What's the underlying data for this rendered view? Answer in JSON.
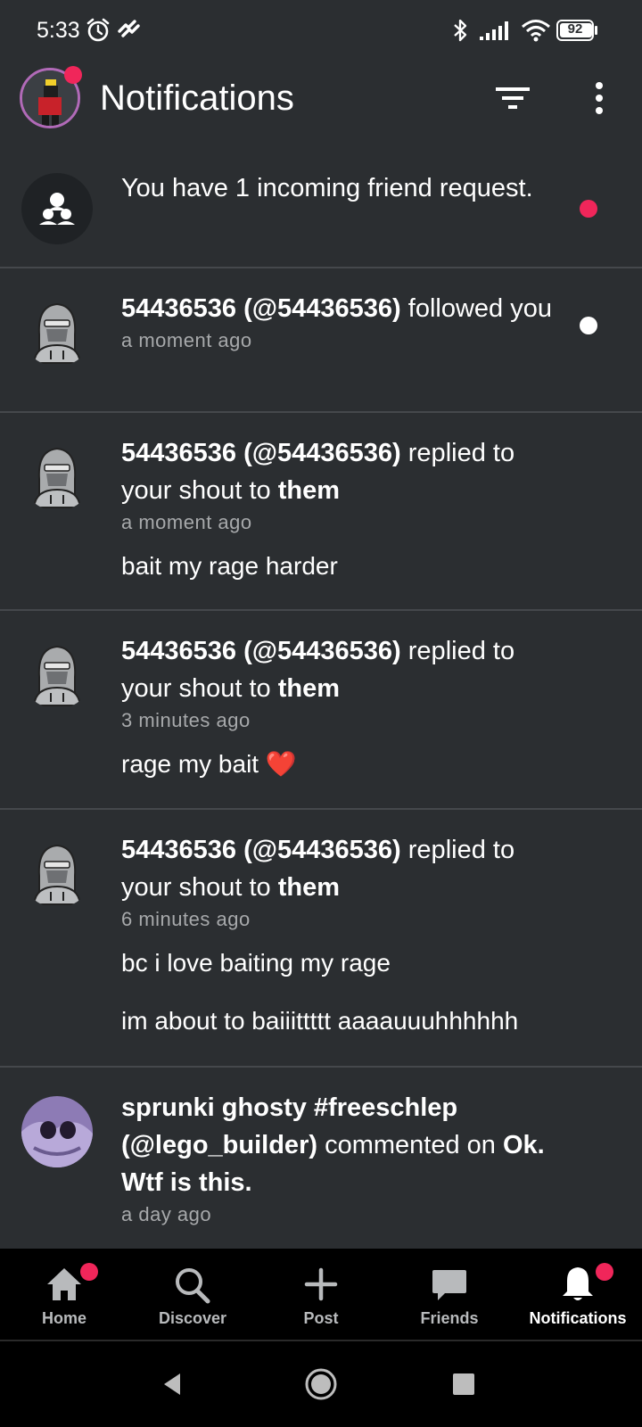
{
  "status_bar": {
    "time": "5:33",
    "battery": "92",
    "icons": [
      "alarm-icon",
      "app-notification-icon",
      "bluetooth-icon",
      "signal-icon",
      "wifi-icon",
      "battery-icon"
    ]
  },
  "header": {
    "title": "Notifications",
    "avatar_badge_color": "#f0265a",
    "actions": [
      "filter-icon",
      "more-vert-icon"
    ]
  },
  "notifications": [
    {
      "type": "friend_request",
      "text": "You have 1 incoming friend request.",
      "unread_color": "#f0265a"
    },
    {
      "type": "follow",
      "user": "54436536 (@54436536)",
      "action": " followed you",
      "time": "a moment ago",
      "unread_color": "#ffffff"
    },
    {
      "type": "reply",
      "user": "54436536 (@54436536)",
      "action": " replied to your shout to ",
      "target": "them",
      "time": "a moment ago",
      "message": "bait my rage harder"
    },
    {
      "type": "reply",
      "user": "54436536 (@54436536)",
      "action": " replied to your shout to ",
      "target": "them",
      "time": "3 minutes ago",
      "message": "rage my bait ❤️"
    },
    {
      "type": "reply",
      "user": "54436536 (@54436536)",
      "action": " replied to your shout to ",
      "target": "them",
      "time": "6 minutes ago",
      "message": "bc i love baiting my rage",
      "message2": "im about to baiiittttt aaaauuuhhhhhh"
    },
    {
      "type": "comment",
      "user": "sprunki ghosty #freeschlep (@lego_builder)",
      "action": " commented on ",
      "target": "Ok. Wtf is this.",
      "time": "a day ago"
    }
  ],
  "bottom_nav": {
    "items": [
      {
        "label": "Home",
        "icon": "home-icon",
        "badge": true,
        "active": false
      },
      {
        "label": "Discover",
        "icon": "search-icon",
        "badge": false,
        "active": false
      },
      {
        "label": "Post",
        "icon": "plus-icon",
        "badge": false,
        "active": false
      },
      {
        "label": "Friends",
        "icon": "chat-bubble-icon",
        "badge": false,
        "active": false
      },
      {
        "label": "Notifications",
        "icon": "bell-icon",
        "badge": true,
        "active": true
      }
    ],
    "badge_color": "#f0265a"
  },
  "system_nav": [
    "back-icon",
    "home-circle-icon",
    "recents-icon"
  ]
}
